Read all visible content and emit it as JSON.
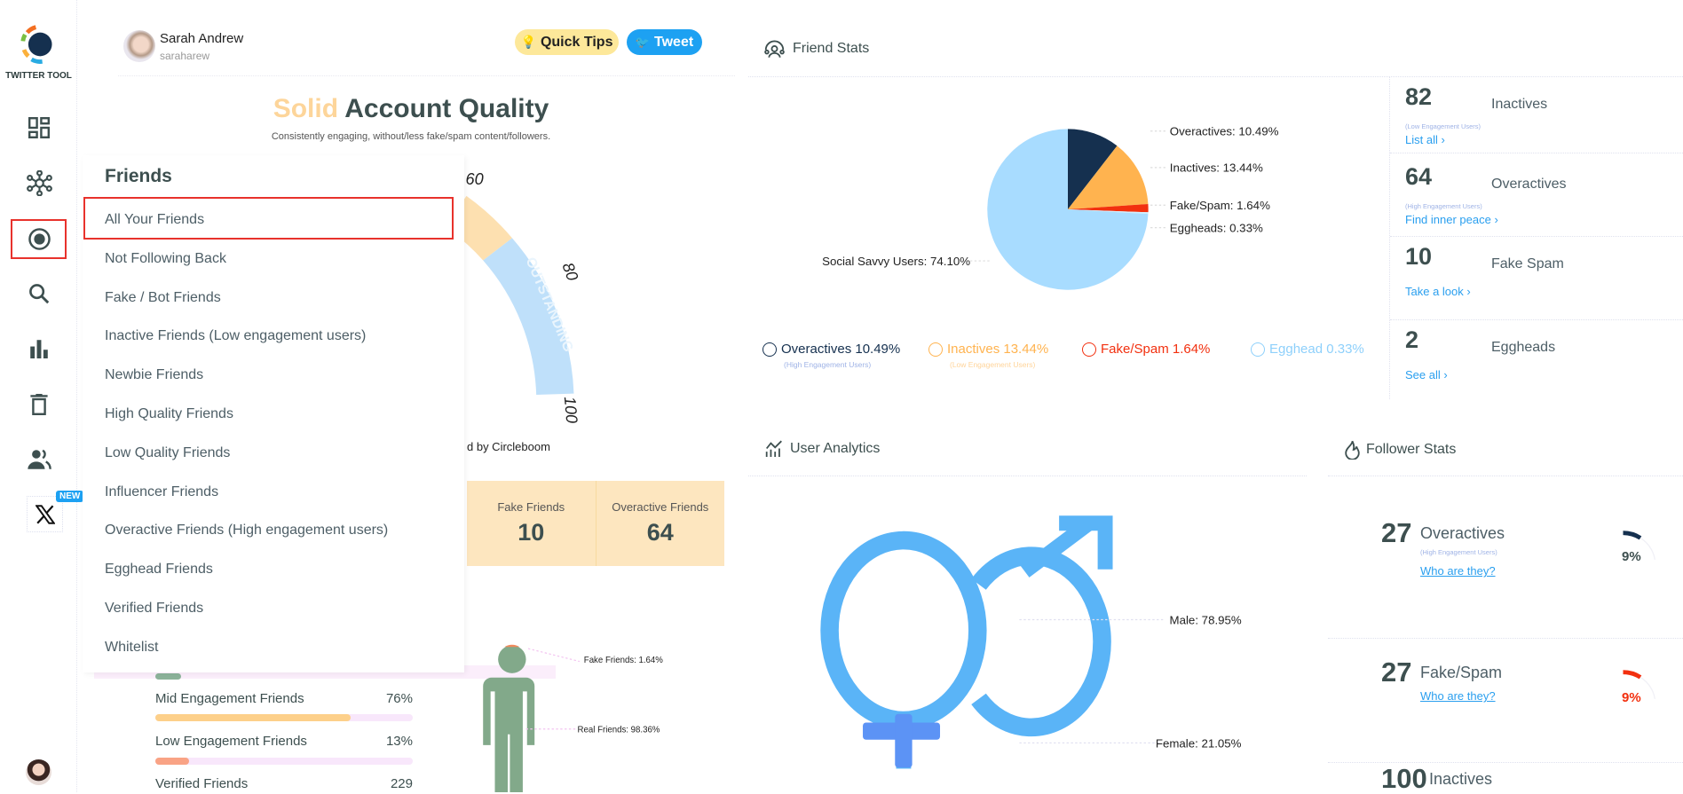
{
  "app": {
    "logo_text": "TWITTER TOOL"
  },
  "sidebar": {
    "items": [
      {
        "icon": "dashboard-icon"
      },
      {
        "icon": "network-icon"
      },
      {
        "icon": "circle-target-icon",
        "selected": true
      },
      {
        "icon": "search-icon"
      },
      {
        "icon": "bar-chart-icon"
      },
      {
        "icon": "trash-icon"
      },
      {
        "icon": "users-icon"
      },
      {
        "icon": "x-logo-icon",
        "badge": "NEW"
      }
    ]
  },
  "header": {
    "user_name": "Sarah Andrew",
    "user_handle": "saraharew",
    "quick_tips": "Quick Tips",
    "tweet": "Tweet"
  },
  "quality": {
    "title_highlight": "Solid",
    "title_rest": "Account Quality",
    "subtitle": "Consistently engaging, without/less fake/spam content/followers.",
    "gauge_labels": [
      "60",
      "80",
      "100"
    ],
    "gauge_band": "OUTSTANDING",
    "powered_by": "d by Circleboom"
  },
  "menu": {
    "title": "Friends",
    "items": [
      "All Your Friends",
      "Not Following Back",
      "Fake / Bot Friends",
      "Inactive Friends (Low engagement users)",
      "Newbie Friends",
      "High Quality Friends",
      "Low Quality Friends",
      "Influencer Friends",
      "Overactive Friends (High engagement users)",
      "Egghead Friends",
      "Verified Friends",
      "Whitelist"
    ],
    "selected_index": 0
  },
  "summary_boxes": [
    {
      "label": "Fake Friends",
      "value": "10"
    },
    {
      "label": "Overactive Friends",
      "value": "64"
    }
  ],
  "engagement": [
    {
      "label": "Mid Engagement Friends",
      "value": "76%",
      "fraction": 0.76,
      "color": "#fdd08a"
    },
    {
      "label": "Low Engagement Friends",
      "value": "13%",
      "fraction": 0.13,
      "color": "#f9a385"
    },
    {
      "label": "Verified Friends",
      "value": "229"
    }
  ],
  "person_chart": {
    "fake_label": "Fake Friends: 1.64%",
    "real_label": "Real Friends: 98.36%"
  },
  "friend_stats": {
    "title": "Friend Stats",
    "pie": [
      {
        "label": "Overactives: 10.49%",
        "value": 10.49,
        "color": "#15304f"
      },
      {
        "label": "Inactives: 13.44%",
        "value": 13.44,
        "color": "#ffb34f"
      },
      {
        "label": "Fake/Spam: 1.64%",
        "value": 1.64,
        "color": "#f2300f"
      },
      {
        "label": "Eggheads: 0.33%",
        "value": 0.33,
        "color": "#cfeeff"
      },
      {
        "label": "Social Savvy Users: 74.10%",
        "value": 74.1,
        "color": "#a8dcff"
      }
    ],
    "legend": [
      {
        "label": "Overactives 10.49%",
        "sub": "(High Engagement Users)",
        "color": "#15304f",
        "sub_color": "#9fb3e6",
        "icon": "head-gear-icon"
      },
      {
        "label": "Inactives 13.44%",
        "sub": "(Low Engagement Users)",
        "color": "#ffb34f",
        "sub_color": "#ffd49a",
        "icon": "sad-face-icon"
      },
      {
        "label": "Fake/Spam 1.64%",
        "sub": "",
        "color": "#f2300f",
        "icon": "angry-face-icon"
      },
      {
        "label": "Egghead 0.33%",
        "sub": "",
        "color": "#8ed0fb",
        "icon": "egg-icon"
      }
    ],
    "side": [
      {
        "num": "82",
        "label": "Inactives",
        "sub": "(Low Engagement Users)",
        "link": "List all ›"
      },
      {
        "num": "64",
        "label": "Overactives",
        "sub": "(High Engagement Users)",
        "link": "Find inner peace ›"
      },
      {
        "num": "10",
        "label": "Fake Spam",
        "sub": "",
        "link": "Take a look ›"
      },
      {
        "num": "2",
        "label": "Eggheads",
        "sub": "",
        "link": "See all ›"
      }
    ]
  },
  "user_analytics": {
    "title": "User Analytics",
    "male": "Male: 78.95%",
    "female": "Female: 21.05%"
  },
  "follower_stats": {
    "title": "Follower Stats",
    "items": [
      {
        "num": "27",
        "label": "Overactives",
        "sub": "(High Engagement Users)",
        "link": "Who are they?",
        "percent": "9%",
        "fraction": 0.09,
        "color": "#15304f"
      },
      {
        "num": "27",
        "label": "Fake/Spam",
        "sub": "",
        "link": "Who are they?",
        "percent": "9%",
        "fraction": 0.09,
        "color": "#f2300f"
      },
      {
        "num": "100",
        "label": "Inactives",
        "sub": "",
        "link": "",
        "percent": ""
      }
    ]
  },
  "colors": {
    "accent": "#1da1f2",
    "link": "#2a9fef",
    "text": "#3d4f4f",
    "highlight": "#fdd59a",
    "selection": "#e8322c"
  }
}
